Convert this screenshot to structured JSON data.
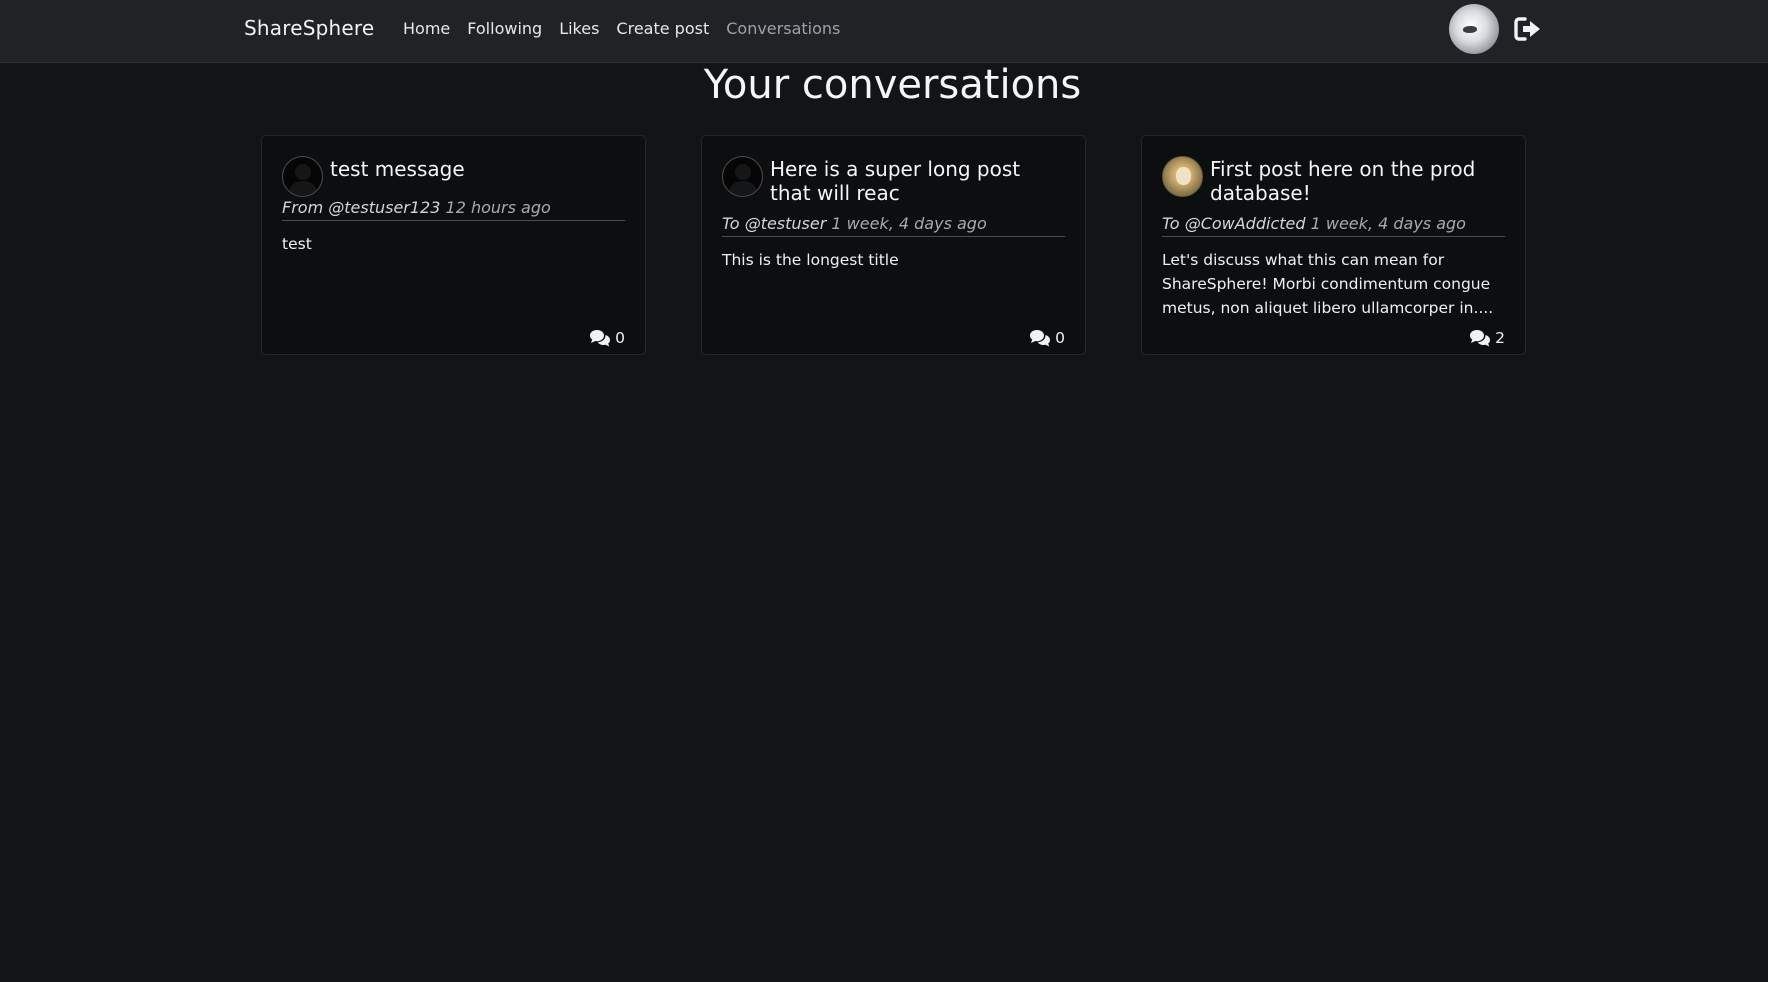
{
  "nav": {
    "brand": "ShareSphere",
    "links": [
      {
        "label": "Home",
        "active": false
      },
      {
        "label": "Following",
        "active": false
      },
      {
        "label": "Likes",
        "active": false
      },
      {
        "label": "Create post",
        "active": false
      },
      {
        "label": "Conversations",
        "active": true
      }
    ],
    "avatar_icon": "user-avatar",
    "logout_icon": "sign-out-icon"
  },
  "page": {
    "title": "Your conversations"
  },
  "conversations": [
    {
      "title": "test message",
      "direction": "From",
      "user": "@testuser123",
      "time": "12 hours ago",
      "body": "test",
      "comment_count": "0",
      "avatar": "default-avatar"
    },
    {
      "title": "Here is a super long post that will reac",
      "direction": "To",
      "user": "@testuser",
      "time": "1 week, 4 days ago",
      "body": "This is the longest title",
      "comment_count": "0",
      "avatar": "default-avatar"
    },
    {
      "title": "First post here on the prod database!",
      "direction": "To",
      "user": "@CowAddicted",
      "time": "1 week, 4 days ago",
      "body": "Let's discuss what this can mean for ShareSphere! Morbi condimentum congue metus, non aliquet libero ullamcorper in....",
      "comment_count": "2",
      "avatar": "photo-avatar"
    }
  ],
  "colors": {
    "background": "#131416",
    "navbar": "#202226",
    "card": "#0d0e10",
    "active_link": "#9ea3aa"
  }
}
